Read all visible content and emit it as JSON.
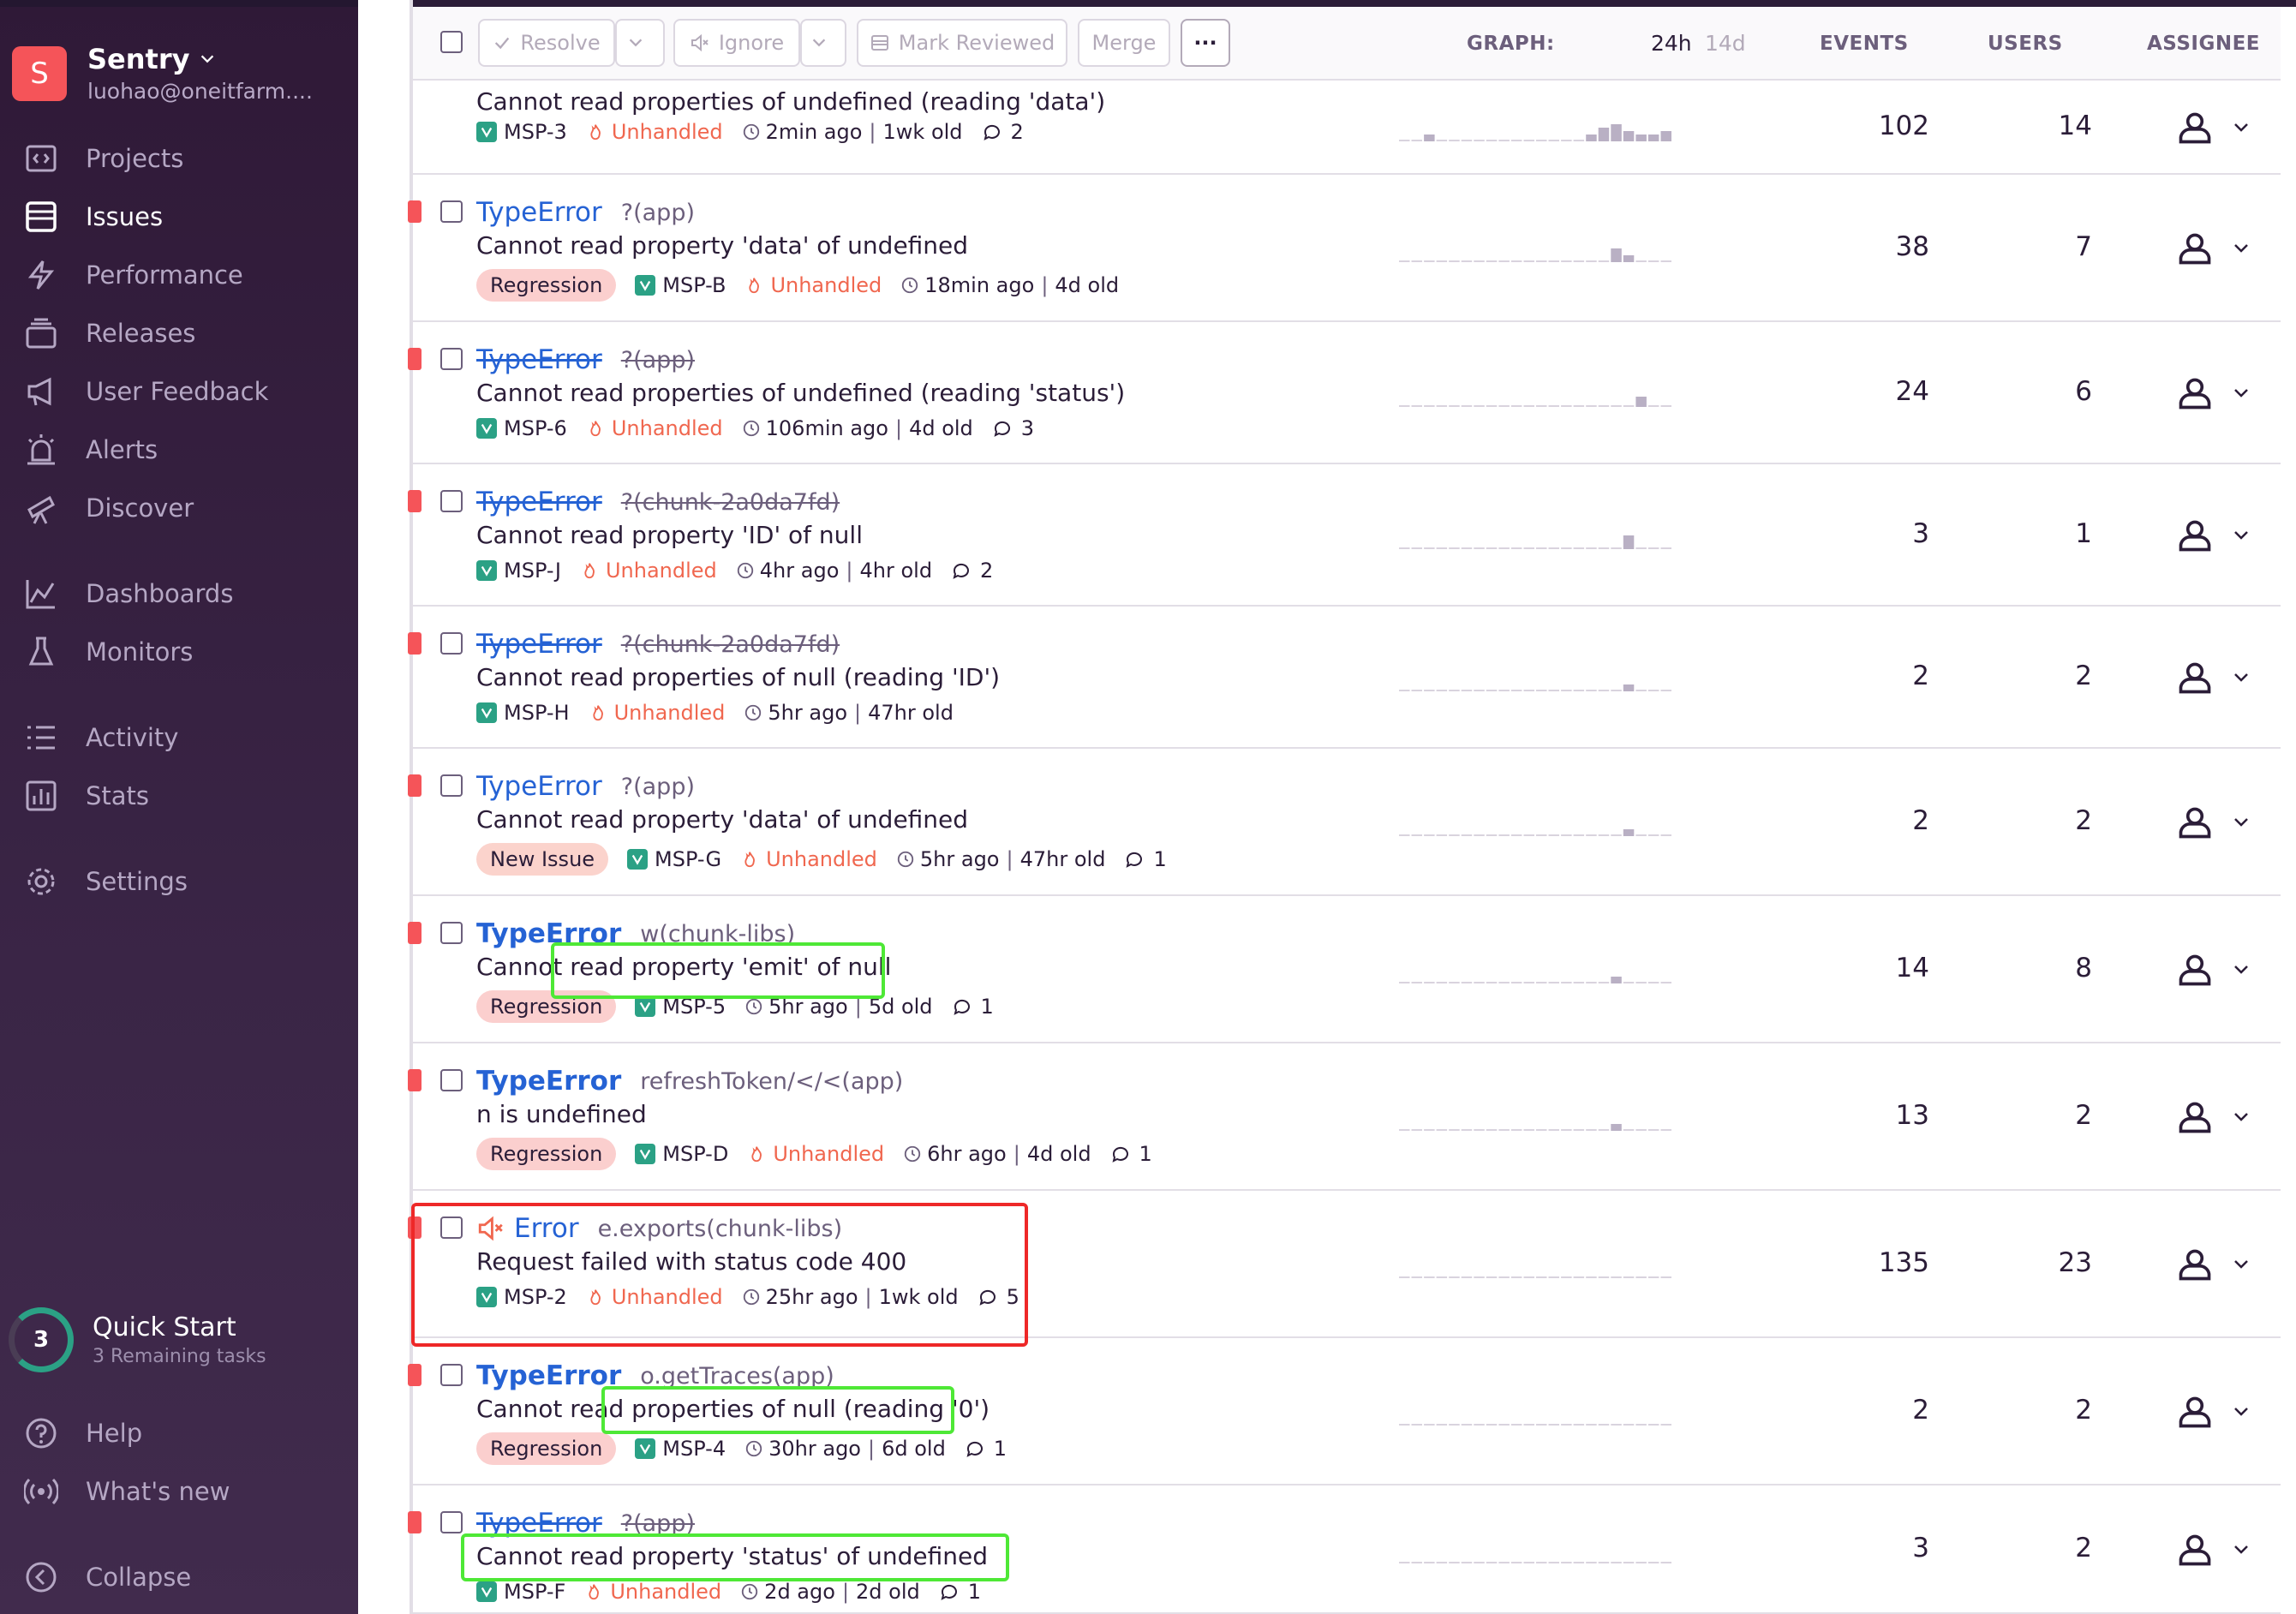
{
  "org": {
    "initial": "S",
    "name": "Sentry",
    "user": "luohao@oneitfarm...."
  },
  "nav": {
    "projects": "Projects",
    "issues": "Issues",
    "performance": "Performance",
    "releases": "Releases",
    "user_feedback": "User Feedback",
    "alerts": "Alerts",
    "discover": "Discover",
    "dashboards": "Dashboards",
    "monitors": "Monitors",
    "activity": "Activity",
    "stats": "Stats",
    "settings": "Settings",
    "help": "Help",
    "whats_new": "What's new",
    "collapse": "Collapse"
  },
  "quick_start": {
    "count": "3",
    "title": "Quick Start",
    "subtitle": "3 Remaining tasks"
  },
  "toolbar": {
    "resolve": "Resolve",
    "ignore": "Ignore",
    "mark_reviewed": "Mark Reviewed",
    "merge": "Merge",
    "more": "···",
    "graph": "GRAPH:",
    "period_24h": "24h",
    "period_14d": "14d",
    "events": "EVENTS",
    "users": "USERS",
    "assignee": "ASSIGNEE"
  },
  "issues": [
    {
      "type": "",
      "culprit": "",
      "message": "Cannot read properties of undefined (reading 'data')",
      "badge": "",
      "short_id": "MSP-3",
      "unhandled": "Unhandled",
      "last_seen": "2min ago",
      "age": "1wk old",
      "comments": "2",
      "events": "102",
      "users": "14"
    },
    {
      "type": "TypeError",
      "culprit": "?(app)",
      "message": "Cannot read property 'data' of undefined",
      "badge": "Regression",
      "short_id": "MSP-B",
      "unhandled": "Unhandled",
      "last_seen": "18min ago",
      "age": "4d old",
      "comments": "",
      "events": "38",
      "users": "7"
    },
    {
      "type": "TypeError",
      "culprit": "?(app)",
      "message": "Cannot read properties of undefined (reading 'status')",
      "badge": "",
      "short_id": "MSP-6",
      "unhandled": "Unhandled",
      "last_seen": "106min ago",
      "age": "4d old",
      "comments": "3",
      "events": "24",
      "users": "6"
    },
    {
      "type": "TypeError",
      "culprit": "?(chunk-2a0da7fd)",
      "message": "Cannot read property 'ID' of null",
      "badge": "",
      "short_id": "MSP-J",
      "unhandled": "Unhandled",
      "last_seen": "4hr ago",
      "age": "4hr old",
      "comments": "2",
      "events": "3",
      "users": "1"
    },
    {
      "type": "TypeError",
      "culprit": "?(chunk-2a0da7fd)",
      "message": "Cannot read properties of null (reading 'ID')",
      "badge": "",
      "short_id": "MSP-H",
      "unhandled": "Unhandled",
      "last_seen": "5hr ago",
      "age": "47hr old",
      "comments": "",
      "events": "2",
      "users": "2"
    },
    {
      "type": "TypeError",
      "culprit": "?(app)",
      "message": "Cannot read property 'data' of undefined",
      "badge": "New Issue",
      "short_id": "MSP-G",
      "unhandled": "Unhandled",
      "last_seen": "5hr ago",
      "age": "47hr old",
      "comments": "1",
      "events": "2",
      "users": "2"
    },
    {
      "type": "TypeError",
      "culprit": "w(chunk-libs)",
      "message": "Cannot read property 'emit' of null",
      "badge": "Regression",
      "short_id": "MSP-5",
      "unhandled": "",
      "last_seen": "5hr ago",
      "age": "5d old",
      "comments": "1",
      "events": "14",
      "users": "8"
    },
    {
      "type": "TypeError",
      "culprit": "refreshToken/</<(app)",
      "message": "n is undefined",
      "badge": "Regression",
      "short_id": "MSP-D",
      "unhandled": "Unhandled",
      "last_seen": "6hr ago",
      "age": "4d old",
      "comments": "1",
      "events": "13",
      "users": "2"
    },
    {
      "type": "Error",
      "culprit": "e.exports(chunk-libs)",
      "message": "Request failed with status code 400",
      "badge": "",
      "short_id": "MSP-2",
      "unhandled": "Unhandled",
      "last_seen": "25hr ago",
      "age": "1wk old",
      "comments": "5",
      "events": "135",
      "users": "23"
    },
    {
      "type": "TypeError",
      "culprit": "o.getTraces(app)",
      "message": "Cannot read properties of null (reading '0')",
      "badge": "Regression",
      "short_id": "MSP-4",
      "unhandled": "",
      "last_seen": "30hr ago",
      "age": "6d old",
      "comments": "1",
      "events": "2",
      "users": "2"
    },
    {
      "type": "TypeError",
      "culprit": "?(app)",
      "message": "Cannot read property 'status' of undefined",
      "badge": "",
      "short_id": "MSP-F",
      "unhandled": "Unhandled",
      "last_seen": "2d ago",
      "age": "2d old",
      "comments": "1",
      "events": "3",
      "users": "2"
    }
  ],
  "colors": {
    "sidebar_bg": "#2f1937",
    "accent_link": "#2562d4",
    "level_error": "#f55459",
    "unhandled": "#f0674f",
    "highlight_red": "#ee2828",
    "highlight_green": "#4ee836"
  }
}
